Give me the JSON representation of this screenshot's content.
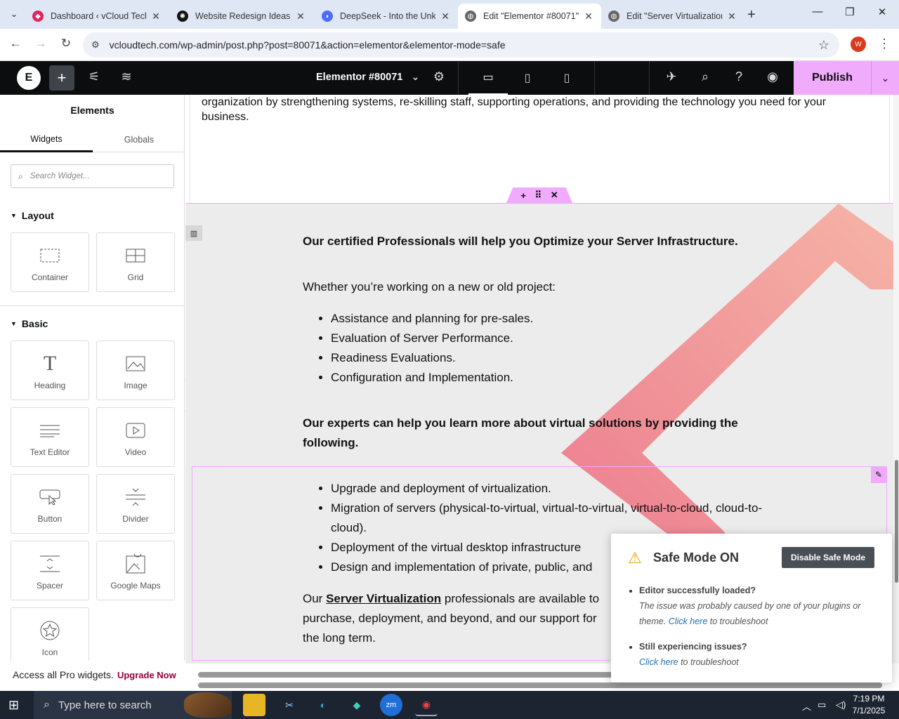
{
  "browser": {
    "tabs": [
      {
        "title": "Dashboard ‹ vCloud Tech",
        "favicon": "wordpress-icon",
        "color": "#e0245e"
      },
      {
        "title": "Website Redesign Ideas",
        "favicon": "chatgpt-icon",
        "color": "#111111"
      },
      {
        "title": "DeepSeek - Into the Unkn",
        "favicon": "deepseek-icon",
        "color": "#4d6bfe"
      },
      {
        "title": "Edit \"Elementor #80071\"",
        "favicon": "globe-icon",
        "color": "#666666"
      },
      {
        "title": "Edit \"Server Virtualization\"",
        "favicon": "globe-icon",
        "color": "#666666"
      }
    ],
    "active_tab": 3,
    "url": "vcloudtech.com/wp-admin/post.php?post=80071&action=elementor&elementor-mode=safe",
    "profile_initial": "W"
  },
  "editor": {
    "doc_title": "Elementor #80071",
    "publish_label": "Publish",
    "logo": "E"
  },
  "panel": {
    "title": "Elements",
    "tab_widgets": "Widgets",
    "tab_globals": "Globals",
    "search_placeholder": "Search Widget...",
    "layout_label": "Layout",
    "basic_label": "Basic",
    "layout_widgets": [
      {
        "label": "Container",
        "icon": "container-icon"
      },
      {
        "label": "Grid",
        "icon": "grid-icon"
      }
    ],
    "basic_widgets": [
      {
        "label": "Heading",
        "icon": "heading-icon"
      },
      {
        "label": "Image",
        "icon": "image-icon"
      },
      {
        "label": "Text Editor",
        "icon": "text-editor-icon"
      },
      {
        "label": "Video",
        "icon": "video-icon"
      },
      {
        "label": "Button",
        "icon": "button-icon"
      },
      {
        "label": "Divider",
        "icon": "divider-icon"
      },
      {
        "label": "Spacer",
        "icon": "spacer-icon"
      },
      {
        "label": "Google Maps",
        "icon": "map-icon"
      },
      {
        "label": "Icon",
        "icon": "star-icon"
      }
    ],
    "footer_text": "Access all Pro widgets.",
    "footer_link": "Upgrade Now"
  },
  "content": {
    "intro": "organization by strengthening systems, re-skilling staff, supporting operations, and providing the technology you need for your business.",
    "heading1": "Our certified Professionals will help you Optimize your Server Infrastructure.",
    "sub1": "Whether you’re working on a new or old project:",
    "list1": [
      "Assistance and planning for pre-sales.",
      "Evaluation of Server Performance.",
      "Readiness Evaluations.",
      "Configuration and Implementation."
    ],
    "heading2": "Our experts can help you learn more about virtual solutions by providing the following.",
    "list2": [
      "Upgrade and deployment of virtualization.",
      "Migration of servers (physical-to-virtual, virtual-to-virtual, virtual-to-cloud, cloud-to-cloud).",
      "Deployment of the virtual desktop infrastructure",
      "Design and implementation of private, public, and"
    ],
    "closing_pre": "Our",
    "closing_link": "Server Virtualization",
    "closing_post": "professionals are available to purchase, deployment, and beyond, and our support for the long term."
  },
  "safe_mode": {
    "title": "Safe Mode ON",
    "button": "Disable Safe Mode",
    "q1": "Editor successfully loaded?",
    "a1": "The issue was probably caused by one of your plugins or theme.",
    "link": "Click here",
    "tail": "to troubleshoot",
    "q2": "Still experiencing issues?"
  },
  "taskbar": {
    "search_placeholder": "Type here to search",
    "time": "7:19 PM",
    "date": "7/1/2025"
  },
  "colors": {
    "accent": "#f0abfc",
    "upgrade": "#93003f",
    "link": "#2271b1",
    "deco": "#f08a96"
  }
}
